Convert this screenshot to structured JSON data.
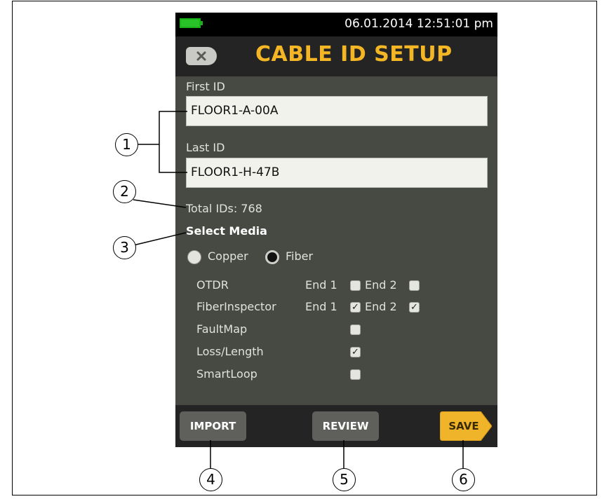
{
  "status_bar": {
    "datetime": "06.01.2014 12:51:01 pm",
    "battery_icon": "battery-full-icon"
  },
  "header": {
    "title": "CABLE ID SETUP",
    "back_icon": "back-close-icon"
  },
  "form": {
    "first_id": {
      "label": "First ID",
      "value": "FLOOR1-A-00A"
    },
    "last_id": {
      "label": "Last ID",
      "value": "FLOOR1-H-47B"
    },
    "total_ids": "Total IDs: 768",
    "select_media_label": "Select Media",
    "media_options": [
      {
        "label": "Copper",
        "selected": false
      },
      {
        "label": "Fiber",
        "selected": true
      }
    ],
    "tests": [
      {
        "name": "OTDR",
        "end1_label": "End 1",
        "end2_label": "End 2",
        "end1": false,
        "end2": false
      },
      {
        "name": "FiberInspector",
        "end1_label": "End 1",
        "end2_label": "End 2",
        "end1": true,
        "end2": true
      },
      {
        "name": "FaultMap",
        "checked": false
      },
      {
        "name": "Loss/Length",
        "checked": true
      },
      {
        "name": "SmartLoop",
        "checked": false
      }
    ]
  },
  "buttons": {
    "import": "IMPORT",
    "review": "REVIEW",
    "save": "SAVE"
  },
  "callouts": [
    "1",
    "2",
    "3",
    "4",
    "5",
    "6"
  ],
  "colors": {
    "title": "#f5b625",
    "save_button": "#f0b42a",
    "screen_bg": "#464a43",
    "battery": "#27c327"
  }
}
